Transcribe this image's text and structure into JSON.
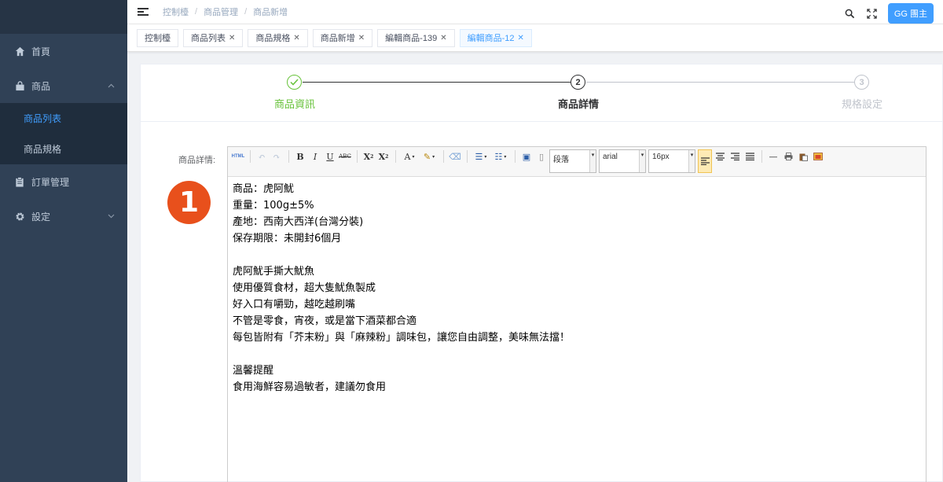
{
  "sidebar": {
    "items": [
      {
        "label": "首頁",
        "icon": "home-icon"
      },
      {
        "label": "商品",
        "icon": "shopping-bag-icon",
        "expanded": true,
        "children": [
          {
            "label": "商品列表",
            "active": true
          },
          {
            "label": "商品規格",
            "active": false
          }
        ]
      },
      {
        "label": "訂單管理",
        "icon": "clipboard-icon"
      },
      {
        "label": "設定",
        "icon": "gear-icon"
      }
    ]
  },
  "topbar": {
    "breadcrumb": [
      "控制檯",
      "商品管理",
      "商品新增"
    ],
    "user_label": "GG 團主"
  },
  "tags": [
    {
      "label": "控制檯",
      "closable": false,
      "active": false
    },
    {
      "label": "商品列表",
      "closable": true,
      "active": false
    },
    {
      "label": "商品規格",
      "closable": true,
      "active": false
    },
    {
      "label": "商品新增",
      "closable": true,
      "active": false
    },
    {
      "label": "編輯商品-139",
      "closable": true,
      "active": false
    },
    {
      "label": "編輯商品-12",
      "closable": true,
      "active": true
    }
  ],
  "steps": [
    {
      "label": "商品資訊",
      "status": "finish",
      "number": "1"
    },
    {
      "label": "商品詳情",
      "status": "process",
      "number": "2"
    },
    {
      "label": "規格設定",
      "status": "wait",
      "number": "3"
    }
  ],
  "form": {
    "detail_label": "商品詳情:",
    "badge_number": "1"
  },
  "editor": {
    "paragraph_select": "段落",
    "font_select": "arial",
    "size_select": "16px",
    "content": [
      "商品：虎阿魷",
      "重量：100g±5%",
      "產地：西南大西洋(台灣分裝)",
      "保存期限：未開封6個月",
      "",
      "虎阿魷手撕大魷魚",
      "使用優質食材，超大隻魷魚製成",
      "好入口有嚼勁，越吃越刷嘴",
      "不管是零食，宵夜，或是當下酒菜都合適",
      "每包皆附有「芥末粉」與「麻辣粉」調味包，讓您自由調整，美味無法擋！",
      "",
      "溫馨提醒",
      "食用海鮮容易過敏者，建議勿食用"
    ]
  },
  "colors": {
    "sidebar_bg": "#304156",
    "accent": "#409eff",
    "success": "#67c23a",
    "badge": "#e8501c"
  }
}
